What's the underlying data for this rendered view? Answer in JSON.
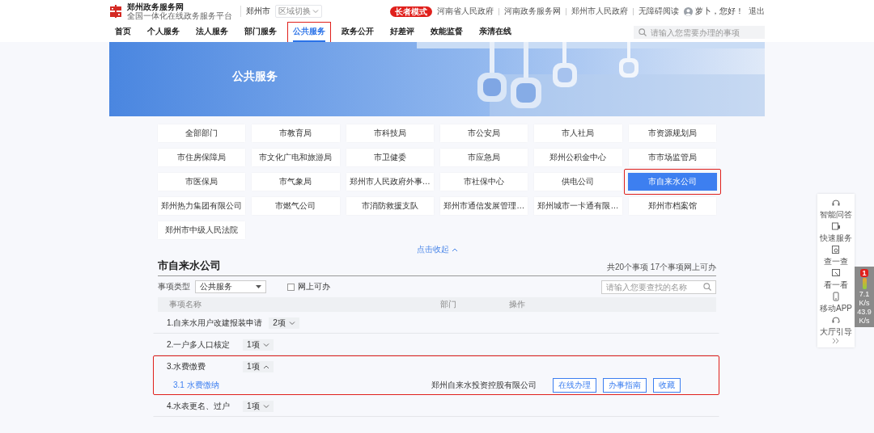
{
  "header": {
    "logo_title": "郑州政务服务网",
    "logo_subtitle": "全国一体化在线政务服务平台",
    "city": "郑州市",
    "region_switch": {
      "label": "区域切换",
      "expanded": false
    },
    "elder_mode": "长者模式",
    "links": [
      "河南省人民政府",
      "河南政务服务网",
      "郑州市人民政府",
      "无障碍阅读"
    ],
    "user": "萝卜，您好！",
    "logout": "退出"
  },
  "nav": {
    "items": [
      {
        "label": "首页",
        "selected": false,
        "highlighted": false
      },
      {
        "label": "个人服务",
        "selected": false,
        "highlighted": false
      },
      {
        "label": "法人服务",
        "selected": false,
        "highlighted": false
      },
      {
        "label": "部门服务",
        "selected": false,
        "highlighted": false
      },
      {
        "label": "公共服务",
        "selected": true,
        "highlighted": true
      },
      {
        "label": "政务公开",
        "selected": false,
        "highlighted": false
      },
      {
        "label": "好差评",
        "selected": false,
        "highlighted": false
      },
      {
        "label": "效能监督",
        "selected": false,
        "highlighted": false
      },
      {
        "label": "亲清在线",
        "selected": false,
        "highlighted": false
      }
    ],
    "search": {
      "placeholder": "请输入您需要办理的事项"
    }
  },
  "banner": {
    "title": "公共服务",
    "kind": "picture"
  },
  "departments": {
    "items": [
      {
        "label": "全部部门",
        "selected": false,
        "highlighted": false
      },
      {
        "label": "市教育局",
        "selected": false,
        "highlighted": false
      },
      {
        "label": "市科技局",
        "selected": false,
        "highlighted": false
      },
      {
        "label": "市公安局",
        "selected": false,
        "highlighted": false
      },
      {
        "label": "市人社局",
        "selected": false,
        "highlighted": false
      },
      {
        "label": "市资源规划局",
        "selected": false,
        "highlighted": false
      },
      {
        "label": "市住房保障局",
        "selected": false,
        "highlighted": false
      },
      {
        "label": "市文化广电和旅游局",
        "selected": false,
        "highlighted": false
      },
      {
        "label": "市卫健委",
        "selected": false,
        "highlighted": false
      },
      {
        "label": "市应急局",
        "selected": false,
        "highlighted": false
      },
      {
        "label": "郑州公积金中心",
        "selected": false,
        "highlighted": false
      },
      {
        "label": "市市场监管局",
        "selected": false,
        "highlighted": false
      },
      {
        "label": "市医保局",
        "selected": false,
        "highlighted": false
      },
      {
        "label": "市气象局",
        "selected": false,
        "highlighted": false
      },
      {
        "label": "郑州市人民政府外事…",
        "selected": false,
        "highlighted": false
      },
      {
        "label": "市社保中心",
        "selected": false,
        "highlighted": false
      },
      {
        "label": "供电公司",
        "selected": false,
        "highlighted": false
      },
      {
        "label": "市自来水公司",
        "selected": true,
        "highlighted": true
      },
      {
        "label": "郑州热力集团有限公司",
        "selected": false,
        "highlighted": false
      },
      {
        "label": "市燃气公司",
        "selected": false,
        "highlighted": false
      },
      {
        "label": "市消防救援支队",
        "selected": false,
        "highlighted": false
      },
      {
        "label": "郑州市通信发展管理…",
        "selected": false,
        "highlighted": false
      },
      {
        "label": "郑州城市一卡通有限…",
        "selected": false,
        "highlighted": false
      },
      {
        "label": "郑州市档案馆",
        "selected": false,
        "highlighted": false
      },
      {
        "label": "郑州市中级人民法院",
        "selected": false,
        "highlighted": false
      }
    ],
    "collapse": "点击收起"
  },
  "section": {
    "title": "市自来水公司",
    "summary": "共20个事项 17个事项网上可办",
    "filter_label": "事项类型",
    "type_select": "公共服务",
    "online_only": {
      "label": "网上可办",
      "checked": false
    },
    "search": {
      "placeholder": "请输入您要查找的名称"
    }
  },
  "table": {
    "columns": [
      "事项名称",
      "部门",
      "操作"
    ],
    "rows": [
      {
        "name": "1.自来水用户改建报装申请",
        "count": "2项",
        "expanded": false,
        "highlighted": false
      },
      {
        "name": "2.一户多人口核定",
        "count": "1项",
        "expanded": false,
        "highlighted": false
      },
      {
        "name": "3.水费缴费",
        "count": "1项",
        "expanded": true,
        "highlighted": true,
        "children": [
          {
            "name": "3.1 水费缴纳",
            "department": "郑州自来水投资控股有限公司",
            "actions": [
              "在线办理",
              "办事指南",
              "收藏"
            ]
          }
        ]
      },
      {
        "name": "4.水表更名、过户",
        "count": "1项",
        "expanded": false,
        "highlighted": false
      }
    ]
  },
  "side_toolbar": {
    "items": [
      "智能问答",
      "快速服务",
      "查一查",
      "看一看",
      "移动APP",
      "大厅引导"
    ]
  },
  "speed_monitor": {
    "badge": "1",
    "upload": "7.1",
    "upload_unit": "K/s",
    "download": "43.9",
    "download_unit": "K/s"
  }
}
